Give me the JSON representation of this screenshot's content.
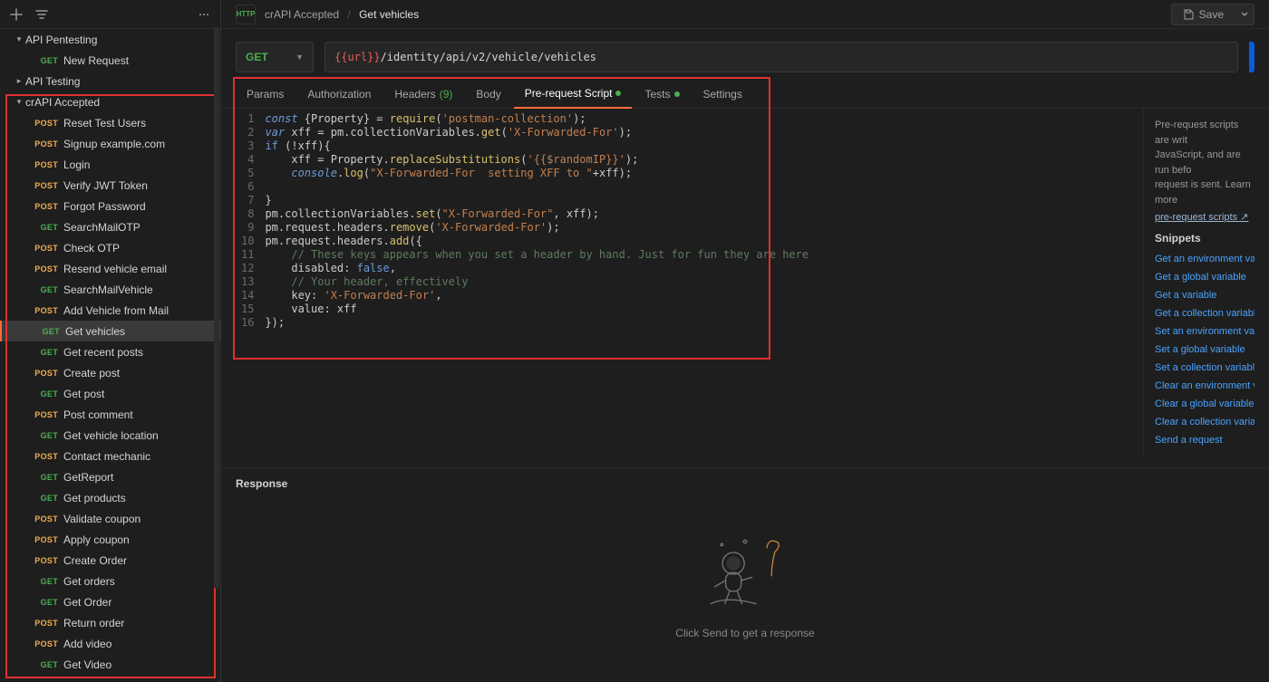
{
  "sidebar": {
    "folders": [
      {
        "name": "API Pentesting",
        "expanded": true,
        "items": [
          {
            "method": "GET",
            "label": "New Request"
          }
        ]
      },
      {
        "name": "API Testing",
        "expanded": false,
        "items": []
      },
      {
        "name": "crAPI Accepted",
        "expanded": true,
        "items": [
          {
            "method": "POST",
            "label": "Reset Test Users"
          },
          {
            "method": "POST",
            "label": "Signup example.com"
          },
          {
            "method": "POST",
            "label": "Login"
          },
          {
            "method": "POST",
            "label": "Verify JWT Token"
          },
          {
            "method": "POST",
            "label": "Forgot Password"
          },
          {
            "method": "GET",
            "label": "SearchMailOTP"
          },
          {
            "method": "POST",
            "label": "Check OTP"
          },
          {
            "method": "POST",
            "label": "Resend vehicle email"
          },
          {
            "method": "GET",
            "label": "SearchMailVehicle"
          },
          {
            "method": "POST",
            "label": "Add Vehicle from Mail"
          },
          {
            "method": "GET",
            "label": "Get vehicles",
            "active": true
          },
          {
            "method": "GET",
            "label": "Get recent posts"
          },
          {
            "method": "POST",
            "label": "Create post"
          },
          {
            "method": "GET",
            "label": "Get post"
          },
          {
            "method": "POST",
            "label": "Post comment"
          },
          {
            "method": "GET",
            "label": "Get vehicle location"
          },
          {
            "method": "POST",
            "label": "Contact mechanic"
          },
          {
            "method": "GET",
            "label": "GetReport"
          },
          {
            "method": "GET",
            "label": "Get products"
          },
          {
            "method": "POST",
            "label": "Validate coupon"
          },
          {
            "method": "POST",
            "label": "Apply coupon"
          },
          {
            "method": "POST",
            "label": "Create Order"
          },
          {
            "method": "GET",
            "label": "Get orders"
          },
          {
            "method": "GET",
            "label": "Get Order"
          },
          {
            "method": "POST",
            "label": "Return order"
          },
          {
            "method": "POST",
            "label": "Add video"
          },
          {
            "method": "GET",
            "label": "Get Video"
          }
        ]
      }
    ]
  },
  "header": {
    "http_icon": "HTTP",
    "crumb_parent": "crAPI Accepted",
    "crumb_sep": "/",
    "crumb_name": "Get vehicles",
    "save_label": "Save"
  },
  "request": {
    "method": "GET",
    "url_var": "{{url}}",
    "url_path": "/identity/api/v2/vehicle/vehicles"
  },
  "tabs": {
    "params": "Params",
    "auth": "Authorization",
    "headers": "Headers",
    "headers_count": "(9)",
    "body": "Body",
    "pre": "Pre-request Script",
    "tests": "Tests",
    "settings": "Settings"
  },
  "code_lines": [
    "1",
    "2",
    "3",
    "4",
    "5",
    "6",
    "7",
    "8",
    "9",
    "10",
    "11",
    "12",
    "13",
    "14",
    "15",
    "16"
  ],
  "right": {
    "info1": "Pre-request scripts are writ",
    "info2": "JavaScript, and are run befo",
    "info3": "request is sent. Learn more",
    "learn": "pre-request scripts ↗",
    "snippets_title": "Snippets",
    "snips": [
      "Get an environment variable",
      "Get a global variable",
      "Get a variable",
      "Get a collection variable",
      "Set an environment variable",
      "Set a global variable",
      "Set a collection variable",
      "Clear an environment variab",
      "Clear a global variable",
      "Clear a collection variable",
      "Send a request"
    ]
  },
  "response": {
    "title": "Response",
    "empty": "Click Send to get a response"
  },
  "colors": {
    "accent": "#ff6c37",
    "get": "#4caf50",
    "post": "#f0ad4e",
    "link": "#4aa3ff"
  }
}
